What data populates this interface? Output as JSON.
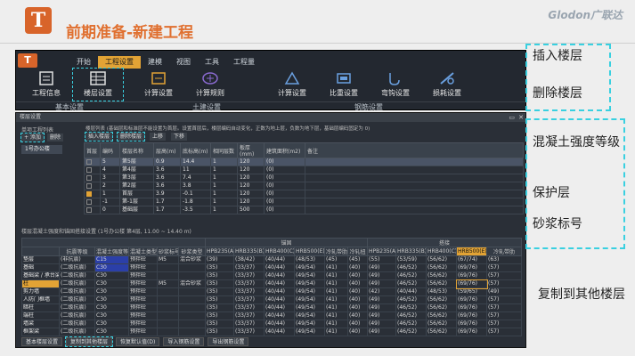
{
  "slide": {
    "title": "前期准备-新建工程",
    "brand": "Glodon广联达",
    "logo_letter": "T"
  },
  "ribbon": {
    "tabs": [
      "开始",
      "工程设置",
      "建模",
      "视图",
      "工具",
      "工程量"
    ],
    "active_tab": 1,
    "buttons": [
      "工程信息",
      "楼层设置",
      "计算设置",
      "计算规则",
      "计算设置",
      "比重设置",
      "弯钩设置",
      "损耗设置"
    ],
    "groups": [
      "基本设置",
      "土建设置",
      "钢筋设置"
    ]
  },
  "dialog": {
    "title": "楼层设置",
    "left_label": "单项工程列表",
    "left_add": "+ 添加",
    "left_delete": "删除",
    "left_item": "1号办公楼",
    "hint": "楼层列表 (基础层和标准层不能设置为首层。设置首层后，楼层编码自动变化，正数为地上层，负数为地下层，基础层编码固定为 0)",
    "btn_insert": "插入楼层",
    "btn_delete": "删除楼层",
    "btn_up": "上移",
    "btn_down": "下移",
    "floor_headers": [
      "首层",
      "编码",
      "楼层名称",
      "层高(m)",
      "底标高(m)",
      "相同层数",
      "板厚(mm)",
      "建筑面积(m2)",
      "备注"
    ],
    "floors": [
      [
        "",
        "5",
        "第5层",
        "0.9",
        "14.4",
        "1",
        "120",
        "(0)",
        ""
      ],
      [
        "",
        "4",
        "第4层",
        "3.6",
        "11",
        "1",
        "120",
        "(0)",
        ""
      ],
      [
        "",
        "3",
        "第3层",
        "3.6",
        "7.4",
        "1",
        "120",
        "(0)",
        ""
      ],
      [
        "",
        "2",
        "第2层",
        "3.6",
        "3.8",
        "1",
        "120",
        "(0)",
        ""
      ],
      [
        "on",
        "1",
        "首层",
        "3.9",
        "-0.1",
        "1",
        "120",
        "(0)",
        ""
      ],
      [
        "",
        "-1",
        "第-1层",
        "1.7",
        "-1.8",
        "1",
        "120",
        "(0)",
        ""
      ],
      [
        "",
        "0",
        "基础层",
        "1.7",
        "-3.5",
        "1",
        "500",
        "(0)",
        ""
      ]
    ],
    "section_label": "楼层混凝土强度和锚固搭接设置 (1号办公楼 第4层, 11.00 ~ 14.40 m)",
    "mix_group_anchor": "锚固",
    "mix_group_lap": "搭接",
    "mix_headers": [
      "",
      "抗震等级",
      "混凝土强度等级",
      "混凝土类型",
      "砂浆标号",
      "砂浆类型",
      "HPB235(A)",
      "HRB335(B)",
      "HRB400(C)",
      "HRB500(E)",
      "冷轧带肋",
      "冷轧扭",
      "HPB235(A)",
      "HRB335(B)",
      "HRB400(C)",
      "HRB500(E)",
      "冷轧带肋"
    ],
    "mix_rows": [
      [
        "垫层",
        "(非抗震)",
        "C15",
        "预拌砼",
        "M5",
        "混合砂浆",
        "(39)",
        "(38/42)",
        "(40/44)",
        "(48/53)",
        "(45)",
        "(45)",
        "(55)",
        "(53/59)",
        "(56/62)",
        "(67/74)",
        "(63)"
      ],
      [
        "基础",
        "(二级抗震)",
        "C30",
        "预拌砼",
        "",
        "",
        "(35)",
        "(33/37)",
        "(40/44)",
        "(49/54)",
        "(41)",
        "(40)",
        "(49)",
        "(46/52)",
        "(56/62)",
        "(69/76)",
        "(57)"
      ],
      [
        "基础梁 / 承台梁",
        "(二级抗震)",
        "C30",
        "预拌砼",
        "",
        "",
        "(35)",
        "(33/37)",
        "(40/44)",
        "(49/54)",
        "(41)",
        "(40)",
        "(49)",
        "(46/52)",
        "(56/62)",
        "(69/76)",
        "(57)"
      ],
      [
        "柱",
        "(二级抗震)",
        "C30",
        "预拌砼",
        "M5",
        "混合砂浆",
        "(35)",
        "(33/37)",
        "(40/44)",
        "(49/54)",
        "(41)",
        "(40)",
        "(49)",
        "(46/52)",
        "(56/62)",
        "(69/76)",
        "(57)"
      ],
      [
        "剪力墙",
        "(二级抗震)",
        "C30",
        "预拌砼",
        "",
        "",
        "(35)",
        "(33/37)",
        "(40/44)",
        "(49/54)",
        "(41)",
        "(40)",
        "(42)",
        "(40/44)",
        "(48/53)",
        "(59/65)",
        "(49)"
      ],
      [
        "人防门框墙",
        "(二级抗震)",
        "C30",
        "预拌砼",
        "",
        "",
        "(35)",
        "(33/37)",
        "(40/44)",
        "(49/54)",
        "(41)",
        "(40)",
        "(49)",
        "(46/52)",
        "(56/62)",
        "(69/76)",
        "(57)"
      ],
      [
        "暗柱",
        "(二级抗震)",
        "C30",
        "预拌砼",
        "",
        "",
        "(35)",
        "(33/37)",
        "(40/44)",
        "(49/54)",
        "(41)",
        "(40)",
        "(49)",
        "(46/52)",
        "(56/62)",
        "(69/76)",
        "(57)"
      ],
      [
        "端柱",
        "(二级抗震)",
        "C30",
        "预拌砼",
        "",
        "",
        "(35)",
        "(33/37)",
        "(40/44)",
        "(49/54)",
        "(41)",
        "(40)",
        "(49)",
        "(46/52)",
        "(56/62)",
        "(69/76)",
        "(57)"
      ],
      [
        "墙梁",
        "(二级抗震)",
        "C30",
        "预拌砼",
        "",
        "",
        "(35)",
        "(33/37)",
        "(40/44)",
        "(49/54)",
        "(41)",
        "(40)",
        "(49)",
        "(46/52)",
        "(56/62)",
        "(69/76)",
        "(57)"
      ],
      [
        "框架梁",
        "(二级抗震)",
        "C30",
        "预拌砼",
        "",
        "",
        "(35)",
        "(33/37)",
        "(40/44)",
        "(49/54)",
        "(41)",
        "(40)",
        "(49)",
        "(46/52)",
        "(56/62)",
        "(69/76)",
        "(57)"
      ]
    ],
    "bottom_buttons": [
      "基本楼层设置",
      "复制到其他楼层",
      "恢复默认值(D)",
      "导入钢筋设置",
      "导出钢筋设置"
    ]
  },
  "callouts": {
    "insert_floor": "插入楼层",
    "delete_floor": "删除楼层",
    "concrete_grade": "混凝土强度等级",
    "cover": "保护层",
    "mortar": "砂浆标号",
    "copy_floors": "复制到其他楼层"
  },
  "colors": {
    "accent_orange": "#e07030",
    "tab_active": "#e2a335",
    "callout_cyan": "#39d0e0",
    "grade_blue": "#2b3fa8"
  }
}
